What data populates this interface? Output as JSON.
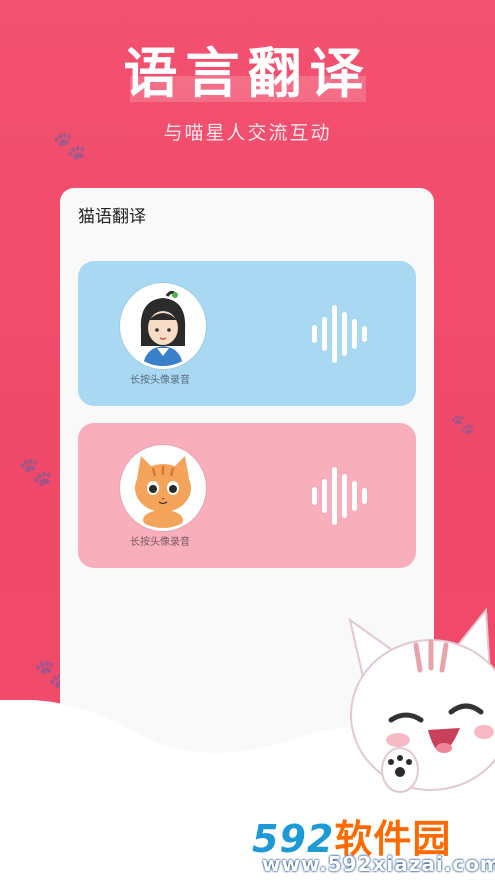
{
  "header": {
    "title": "语言翻译",
    "subtitle": "与喵星人交流互动"
  },
  "card": {
    "title": "猫语翻译",
    "panels": [
      {
        "hint": "长按头像录音",
        "avatar_icon": "girl-avatar-icon",
        "color": "#a9d8f2"
      },
      {
        "hint": "长按头像录音",
        "avatar_icon": "cat-avatar-icon",
        "color": "#f8aebb"
      }
    ]
  },
  "watermark": {
    "number": "592",
    "name": "软件园",
    "url": "www.592xiazai.com"
  },
  "colors": {
    "background": "#f2506e",
    "brand_blue": "#1c9ad6",
    "brand_orange": "#ff6a00"
  }
}
